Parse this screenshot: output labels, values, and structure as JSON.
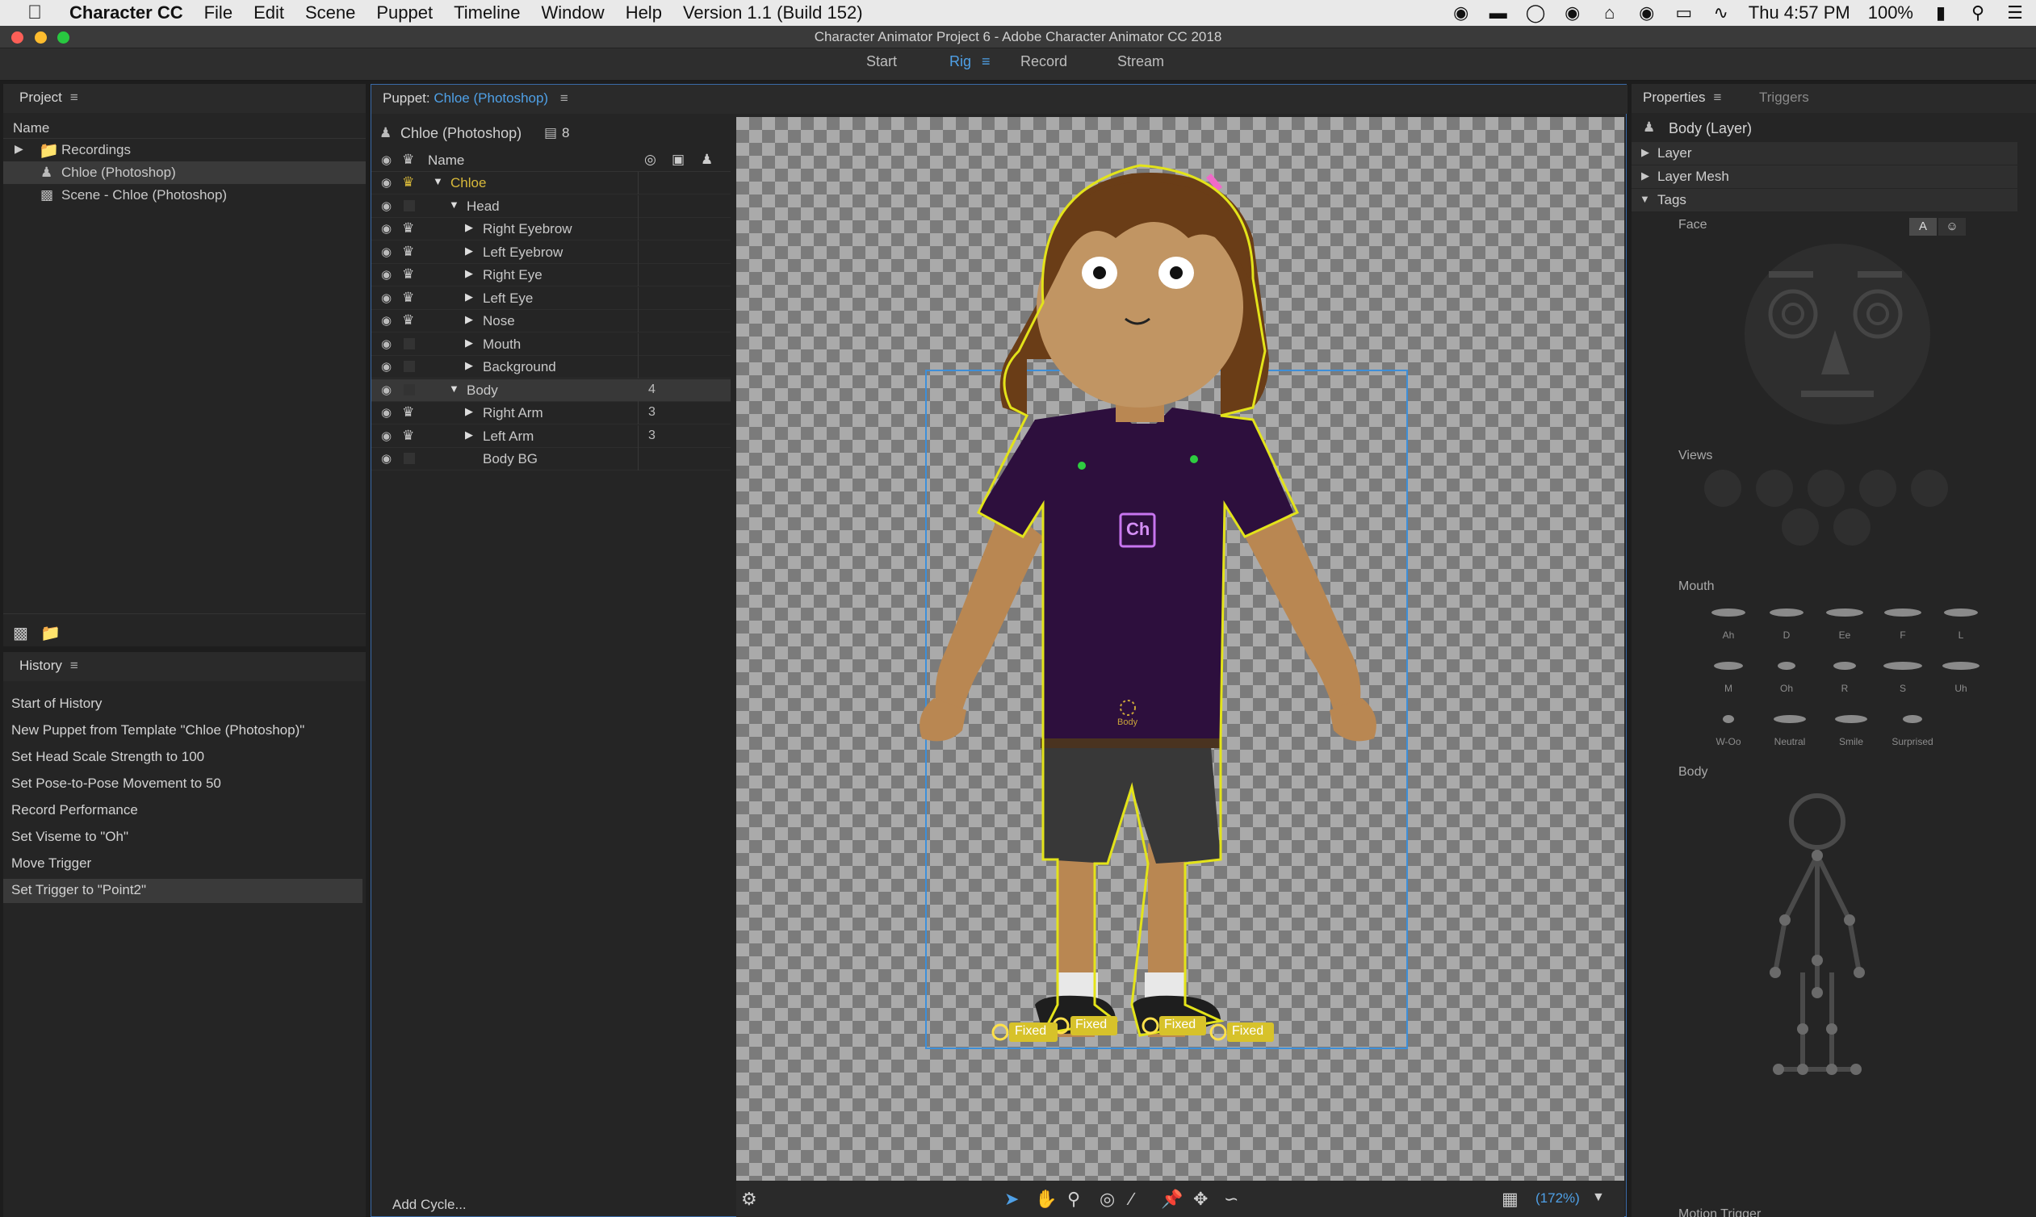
{
  "menubar": {
    "app_name": "Character CC",
    "items": [
      "File",
      "Edit",
      "Scene",
      "Puppet",
      "Timeline",
      "Window",
      "Help",
      "Version 1.1 (Build 152)"
    ],
    "clock": "Thu 4:57 PM",
    "battery": "100%"
  },
  "window": {
    "title": "Character Animator Project 6 - Adobe Character Animator CC 2018"
  },
  "workspaces": {
    "start": "Start",
    "rig": "Rig",
    "record": "Record",
    "stream": "Stream",
    "active": "Rig"
  },
  "project": {
    "tab": "Project",
    "column_name": "Name",
    "items": [
      {
        "label": "Recordings",
        "kind": "folder"
      },
      {
        "label": "Chloe (Photoshop)",
        "kind": "puppet",
        "selected": true
      },
      {
        "label": "Scene - Chloe (Photoshop)",
        "kind": "scene"
      }
    ]
  },
  "history": {
    "tab": "History",
    "items": [
      "Start of History",
      "New Puppet from Template \"Chloe (Photoshop)\"",
      "Set Head Scale Strength to 100",
      "Set Pose-to-Pose Movement to 50",
      "Record Performance",
      "Set Viseme to \"Oh\"",
      "Move Trigger",
      "Set Trigger to \"Point2\""
    ]
  },
  "puppet": {
    "tab_prefix": "Puppet:",
    "tab_name": "Chloe (Photoshop)",
    "header_name": "Chloe (Photoshop)",
    "header_count": "8",
    "column_name": "Name",
    "layers": [
      {
        "name": "Chloe",
        "indent": 0,
        "expanded": true,
        "crown": "gold",
        "count": ""
      },
      {
        "name": "Head",
        "indent": 1,
        "expanded": true,
        "crown": "none",
        "count": ""
      },
      {
        "name": "Right Eyebrow",
        "indent": 2,
        "expanded": false,
        "crown": "white",
        "count": ""
      },
      {
        "name": "Left Eyebrow",
        "indent": 2,
        "expanded": false,
        "crown": "white",
        "count": ""
      },
      {
        "name": "Right Eye",
        "indent": 2,
        "expanded": false,
        "crown": "white",
        "count": ""
      },
      {
        "name": "Left Eye",
        "indent": 2,
        "expanded": false,
        "crown": "white",
        "count": ""
      },
      {
        "name": "Nose",
        "indent": 2,
        "expanded": false,
        "crown": "white",
        "count": ""
      },
      {
        "name": "Mouth",
        "indent": 2,
        "expanded": false,
        "crown": "none",
        "count": ""
      },
      {
        "name": "Background",
        "indent": 2,
        "expanded": false,
        "crown": "none",
        "count": ""
      },
      {
        "name": "Body",
        "indent": 1,
        "expanded": true,
        "crown": "none",
        "count": "4",
        "selected": true
      },
      {
        "name": "Right Arm",
        "indent": 2,
        "expanded": false,
        "crown": "white",
        "count": "3"
      },
      {
        "name": "Left Arm",
        "indent": 2,
        "expanded": false,
        "crown": "white",
        "count": "3"
      },
      {
        "name": "Body BG",
        "indent": 2,
        "expanded": null,
        "crown": "none",
        "count": ""
      }
    ],
    "add_cycle": "Add Cycle...",
    "canvas": {
      "shirt_logo": "Ch",
      "body_label": "Body",
      "fixed_labels": [
        "Fixed",
        "Fixed",
        "Fixed",
        "Fixed"
      ]
    },
    "zoom": "(172%)"
  },
  "properties": {
    "tab": "Properties",
    "tab_triggers": "Triggers",
    "layer_title": "Body (Layer)",
    "sections": [
      "Layer",
      "Layer Mesh",
      "Tags"
    ],
    "face_label": "Face",
    "face_toggle": "A",
    "views_label": "Views",
    "mouth_label": "Mouth",
    "visemes": [
      "Ah",
      "D",
      "Ee",
      "F",
      "L",
      "M",
      "Oh",
      "R",
      "S",
      "Uh",
      "W-Oo",
      "Neutral",
      "Smile",
      "Surprised"
    ],
    "body_label": "Body",
    "motion_trigger_label": "Motion Trigger"
  },
  "colors": {
    "accent": "#4fa0e6",
    "selection": "#d6d61c",
    "panel": "#252525"
  }
}
